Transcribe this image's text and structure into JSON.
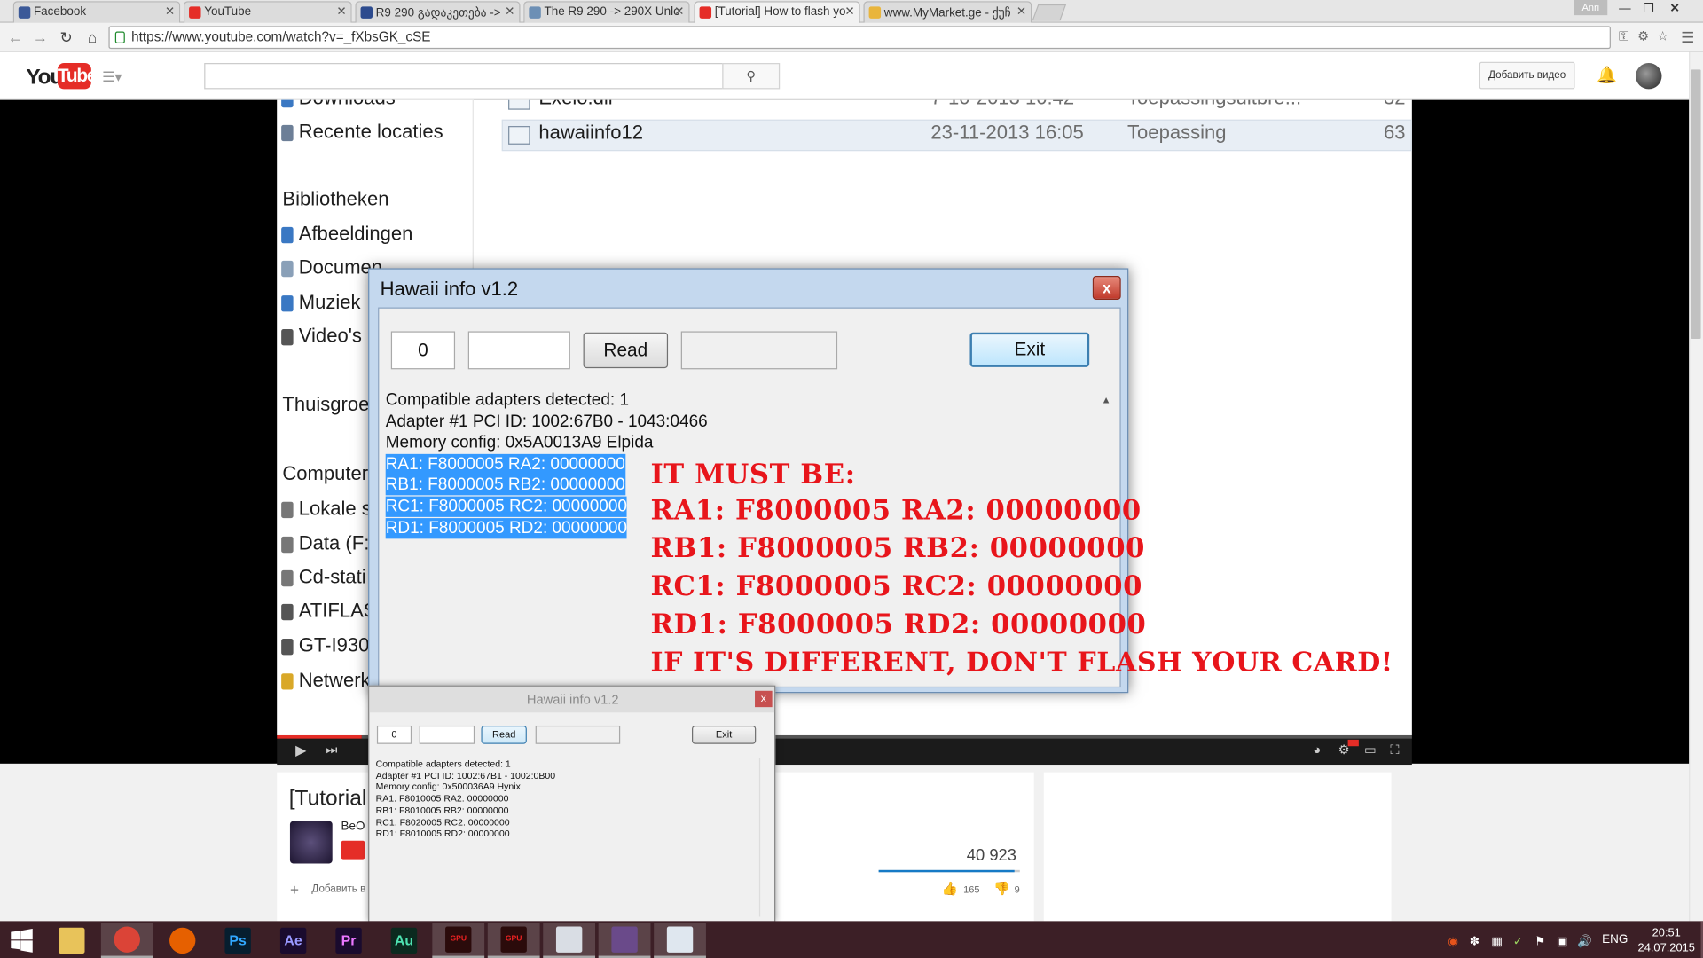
{
  "browser": {
    "tabs": [
      {
        "title": "Facebook",
        "color": "#3b5998",
        "active": false
      },
      {
        "title": "YouTube",
        "color": "#e52d27",
        "active": false
      },
      {
        "title": "R9 290 გადაკეთება -> ",
        "color": "#2d4b8e",
        "active": false
      },
      {
        "title": "The R9 290 -> 290X Unlo",
        "color": "#6c8fb5",
        "active": false
      },
      {
        "title": "[Tutorial] How to flash yo",
        "color": "#e52d27",
        "active": true
      },
      {
        "title": "www.MyMarket.ge - ქუჩ",
        "color": "#e9b53c",
        "active": false
      }
    ],
    "user_badge": "Anri",
    "url": "https://www.youtube.com/watch?v=_fXbsGK_cSE"
  },
  "youtube": {
    "logo_you": "You",
    "logo_tube": "Tube",
    "upload_label": "Добавить видео",
    "video_title_partial": "[Tutorial",
    "channel_partial": "BeO",
    "add_to_label": "Добавить в",
    "views": "40 923",
    "likes": "165",
    "dislikes": "9"
  },
  "explorer": {
    "nav_items": [
      {
        "label": "Downloads",
        "color": "#3a78c3"
      },
      {
        "label": "Recente locaties",
        "color": "#6d7f97"
      },
      {
        "label": "Bibliotheken",
        "color": ""
      },
      {
        "label": "Afbeeldingen",
        "color": "#3a78c3"
      },
      {
        "label": "Documen",
        "color": "#8aa0b8"
      },
      {
        "label": "Muziek",
        "color": "#3a78c3"
      },
      {
        "label": "Video's",
        "color": "#555"
      },
      {
        "label": "Thuisgroe",
        "color": ""
      },
      {
        "label": "Computer",
        "color": ""
      },
      {
        "label": "Lokale s",
        "color": "#777"
      },
      {
        "label": "Data (F:",
        "color": "#777"
      },
      {
        "label": "Cd-stati",
        "color": "#777"
      },
      {
        "label": "ATIFLAS",
        "color": "#555"
      },
      {
        "label": "GT-I930",
        "color": "#555"
      },
      {
        "label": "Netwerk",
        "color": "#d9a828"
      }
    ],
    "files": [
      {
        "name": "Exelo.dll",
        "date": "7-10-2013 10:42",
        "type": "Toepassingsuitbre...",
        "size": "32"
      },
      {
        "name": "hawaiinfo12",
        "date": "23-11-2013 16:05",
        "type": "Toepassing",
        "size": "63"
      }
    ]
  },
  "hawaii_big": {
    "title": "Hawaii info v1.2",
    "close_label": "x",
    "adapter_input": "0",
    "read_label": "Read",
    "exit_label": "Exit",
    "log": [
      "Compatible adapters detected: 1",
      "Adapter #1 PCI ID: 1002:67B0 - 1043:0466",
      "Memory config: 0x5A0013A9 Elpida",
      "RA1: F8000005 RA2: 00000000",
      "RB1: F8000005 RB2: 00000000",
      "RC1: F8000005 RC2: 00000000",
      "RD1: F8000005 RD2: 00000000"
    ]
  },
  "overlay": {
    "lines": [
      "IT MUST BE:",
      "RA1: F8000005 RA2: 00000000",
      "RB1: F8000005 RB2: 00000000",
      "RC1: F8000005 RC2: 00000000",
      "RD1: F8000005 RD2: 00000000",
      "IF IT'S DIFFERENT, DON'T FLASH YOUR CARD!"
    ]
  },
  "hawaii_small": {
    "title": "Hawaii info v1.2",
    "close_label": "x",
    "adapter_input": "0",
    "read_label": "Read",
    "exit_label": "Exit",
    "log": [
      "Compatible adapters detected: 1",
      "Adapter #1 PCI ID: 1002:67B1 - 1002:0B00",
      "Memory config: 0x500036A9 Hynix",
      "RA1: F8010005 RA2: 00000000",
      "RB1: F8010005 RB2: 00000000",
      "RC1: F8020005 RC2: 00000000",
      "RD1: F8010005 RD2: 00000000"
    ]
  },
  "taskbar": {
    "apps": [
      {
        "name": "file-explorer",
        "label": "",
        "bg": "#e8c35a",
        "fg": "#6b4b12",
        "active": false
      },
      {
        "name": "chrome",
        "label": "",
        "bg": "#db4437",
        "fg": "#fff",
        "active": true
      },
      {
        "name": "firefox",
        "label": "",
        "bg": "#e66000",
        "fg": "#fff",
        "active": false
      },
      {
        "name": "photoshop",
        "label": "Ps",
        "bg": "#061e2f",
        "fg": "#31a8ff",
        "active": false
      },
      {
        "name": "after-effects",
        "label": "Ae",
        "bg": "#1a0b2e",
        "fg": "#9999ff",
        "active": false
      },
      {
        "name": "premiere",
        "label": "Pr",
        "bg": "#1a0b2e",
        "fg": "#ea77ff",
        "active": false
      },
      {
        "name": "audition",
        "label": "Au",
        "bg": "#0b2a1f",
        "fg": "#4ee2b1",
        "active": false
      },
      {
        "name": "gpu-tweak",
        "label": "GPU",
        "bg": "#2b0b0b",
        "fg": "#e22",
        "active": true
      },
      {
        "name": "gpu-monitor",
        "label": "GPU",
        "bg": "#2b0b0b",
        "fg": "#e22",
        "active": true
      },
      {
        "name": "calculator",
        "label": "",
        "bg": "#d9dde4",
        "fg": "#333",
        "active": true
      },
      {
        "name": "winrar",
        "label": "",
        "bg": "#6a4a8a",
        "fg": "#fff",
        "active": true
      },
      {
        "name": "hawaii-info",
        "label": "",
        "bg": "#dfe7ef",
        "fg": "#333",
        "active": true
      }
    ],
    "language": "ENG",
    "time": "20:51",
    "date": "24.07.2015"
  }
}
